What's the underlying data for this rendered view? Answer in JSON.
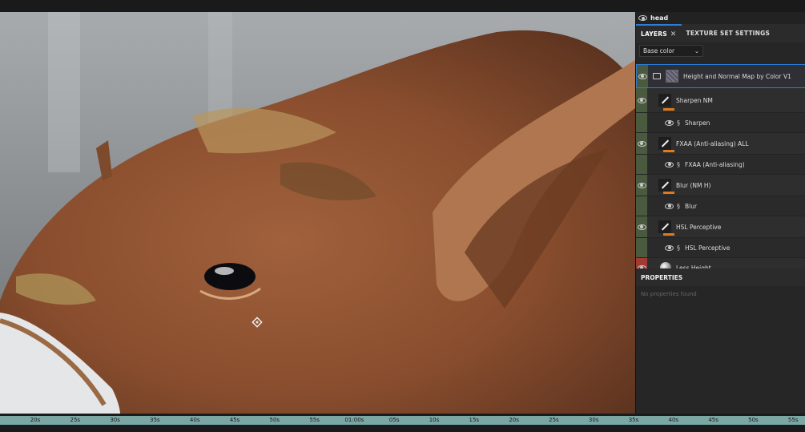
{
  "texture_set": {
    "name": "head"
  },
  "tabs": [
    {
      "label": "LAYERS",
      "active": true,
      "closable": true
    },
    {
      "label": "TEXTURE SET SETTINGS",
      "active": false,
      "closable": false
    }
  ],
  "channel_select": {
    "value": "Base color"
  },
  "layers": [
    {
      "type": "folder",
      "name": "Height and Normal Map by Color V1",
      "icon": "folder-icon"
    },
    {
      "type": "layer",
      "name": "Sharpen NM",
      "filter": "Sharpen"
    },
    {
      "type": "layer",
      "name": "FXAA (Anti-aliasing) ALL",
      "filter": "FXAA (Anti-aliasing)"
    },
    {
      "type": "layer",
      "name": "Blur (NM H)",
      "filter": "Blur"
    },
    {
      "type": "layer",
      "name": "HSL Perceptive",
      "filter": "HSL Perceptive"
    },
    {
      "type": "fill",
      "name": "Less Height"
    }
  ],
  "properties": {
    "title": "PROPERTIES",
    "empty_text": "No properties found"
  },
  "timeline": {
    "ticks": [
      "20s",
      "25s",
      "30s",
      "35s",
      "40s",
      "45s",
      "50s",
      "55s",
      "01:00s",
      "05s",
      "10s",
      "15s",
      "20s",
      "25s",
      "30s",
      "35s",
      "40s",
      "45s",
      "50s",
      "55s"
    ]
  },
  "colors": {
    "accent": "#2c7dd6",
    "layer_strip": "#4a5a3e",
    "fill_strip": "#a13a33",
    "mask_bar": "#e07a1f"
  }
}
